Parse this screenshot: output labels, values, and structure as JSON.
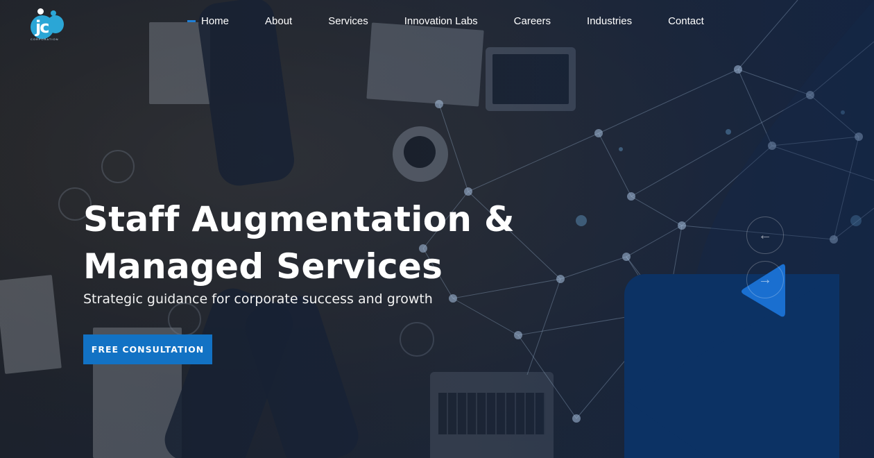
{
  "brand": {
    "logo_mark": "jc",
    "logo_caption": "CORPORATION"
  },
  "nav": {
    "items": [
      "Home",
      "About",
      "Services",
      "Innovation Labs",
      "Careers",
      "Industries",
      "Contact"
    ]
  },
  "hero": {
    "title_line1": "Staff Augmentation &",
    "title_line2": "Managed Services",
    "subtitle": "Strategic guidance for corporate success and growth",
    "cta_label": "FREE CONSULTATION"
  },
  "slider": {
    "prev_icon": "←",
    "next_icon": "→"
  },
  "colors": {
    "accent": "#1272c4",
    "shape_dark": "#0c3264",
    "shape_bright": "#1a6fd0",
    "logo_blue": "#2ba6d6"
  },
  "icons": [
    "arrow-left-icon",
    "arrow-right-icon"
  ]
}
